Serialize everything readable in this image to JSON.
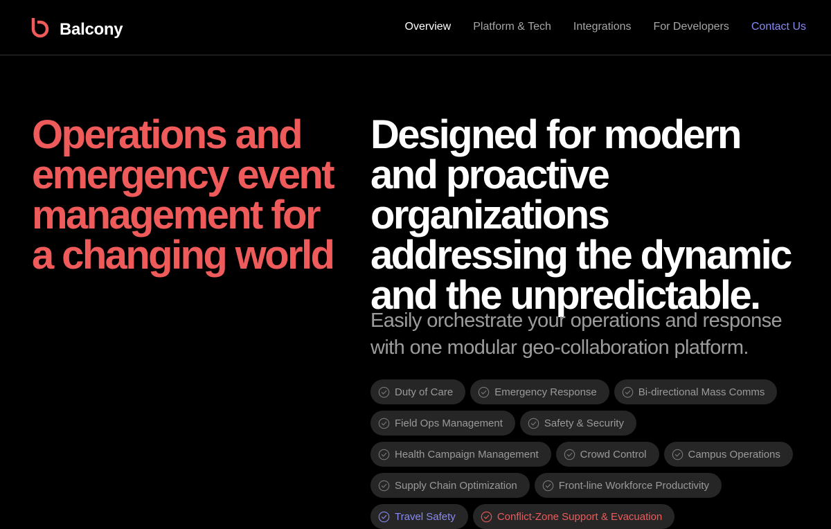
{
  "brand": {
    "name": "Balcony",
    "logo_icon": "balcony-logo-icon",
    "accent_color": "#ef5a5a"
  },
  "nav": {
    "items": [
      {
        "label": "Overview",
        "state": "active"
      },
      {
        "label": "Platform & Tech",
        "state": "default"
      },
      {
        "label": "Integrations",
        "state": "default"
      },
      {
        "label": "For Developers",
        "state": "default"
      },
      {
        "label": "Contact Us",
        "state": "highlight"
      }
    ],
    "active_color": "#ffffff",
    "default_color": "#a6a6a6",
    "highlight_color": "#8a8af5"
  },
  "hero": {
    "left_heading": "Operations and emergency event management for a changing world",
    "right_heading": "Designed for modern and proactive organizations addressing the dynamic and the unpredictable.",
    "subtitle": "Easily orchestrate your operations and response with one modular geo-collaboration platform."
  },
  "tags": {
    "icon": "check-circle-icon",
    "items": [
      {
        "label": "Duty of Care",
        "variant": "default"
      },
      {
        "label": "Emergency Response",
        "variant": "default"
      },
      {
        "label": "Bi-directional Mass Comms",
        "variant": "default"
      },
      {
        "label": "Field Ops Management",
        "variant": "default"
      },
      {
        "label": "Safety & Security",
        "variant": "default"
      },
      {
        "label": "Health Campaign Management",
        "variant": "default"
      },
      {
        "label": "Crowd Control",
        "variant": "default"
      },
      {
        "label": "Campus Operations",
        "variant": "default"
      },
      {
        "label": "Supply Chain Optimization",
        "variant": "default"
      },
      {
        "label": "Front-line Workforce Productivity",
        "variant": "default"
      },
      {
        "label": "Travel Safety",
        "variant": "blue"
      },
      {
        "label": "Conflict-Zone Support & Evacuation",
        "variant": "red"
      }
    ]
  }
}
